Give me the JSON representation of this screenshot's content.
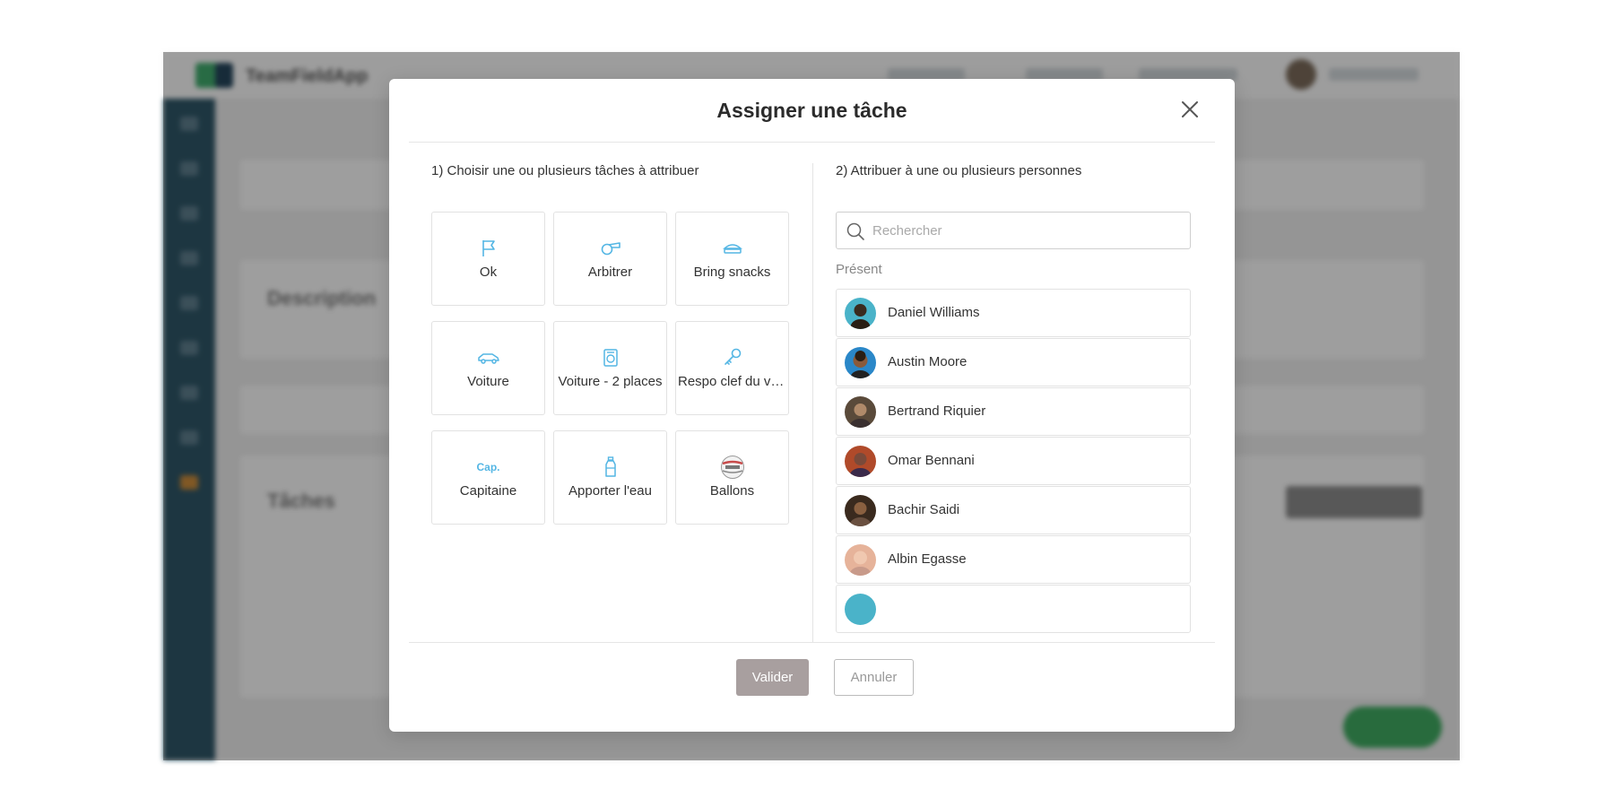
{
  "background": {
    "app_name": "TeamFieldApp",
    "section_description": "Description",
    "section_tasks": "Tâches"
  },
  "modal": {
    "title": "Assigner une tâche",
    "step1": "1) Choisir une ou plusieurs tâches à attribuer",
    "step2": "2) Attribuer à une ou plusieurs personnes",
    "tasks": [
      {
        "label": "Ok",
        "icon": "flag-icon"
      },
      {
        "label": "Arbitrer",
        "icon": "whistle-icon"
      },
      {
        "label": "Bring snacks",
        "icon": "snack-icon"
      },
      {
        "label": "Voiture",
        "icon": "car-icon"
      },
      {
        "label": "Voiture - 2 places",
        "icon": "car-seat-icon"
      },
      {
        "label": "Respo clef du vestiaire",
        "icon": "key-icon"
      },
      {
        "label": "Capitaine",
        "icon": "captain-icon",
        "icon_text": "Cap."
      },
      {
        "label": "Apporter l'eau",
        "icon": "water-bottle-icon"
      },
      {
        "label": "Ballons",
        "icon": "ball-icon"
      }
    ],
    "search": {
      "placeholder": "Rechercher"
    },
    "present_label": "Présent",
    "people": [
      {
        "name": "Daniel Williams",
        "avatar_color": "#4ab3c9"
      },
      {
        "name": "Austin Moore",
        "avatar_color": "#2a87c8"
      },
      {
        "name": "Bertrand Riquier",
        "avatar_color": "#5a4a3a"
      },
      {
        "name": "Omar Bennani",
        "avatar_color": "#b04a2a"
      },
      {
        "name": "Bachir Saidi",
        "avatar_color": "#3a2a1e"
      },
      {
        "name": "Albin Egasse",
        "avatar_color": "#e6b39a"
      },
      {
        "name": "",
        "avatar_color": "#4ab3c9"
      }
    ],
    "buttons": {
      "validate": "Valider",
      "cancel": "Annuler"
    }
  },
  "colors": {
    "accent_icon": "#54b6e4",
    "primary_button": "#a89f9f"
  }
}
